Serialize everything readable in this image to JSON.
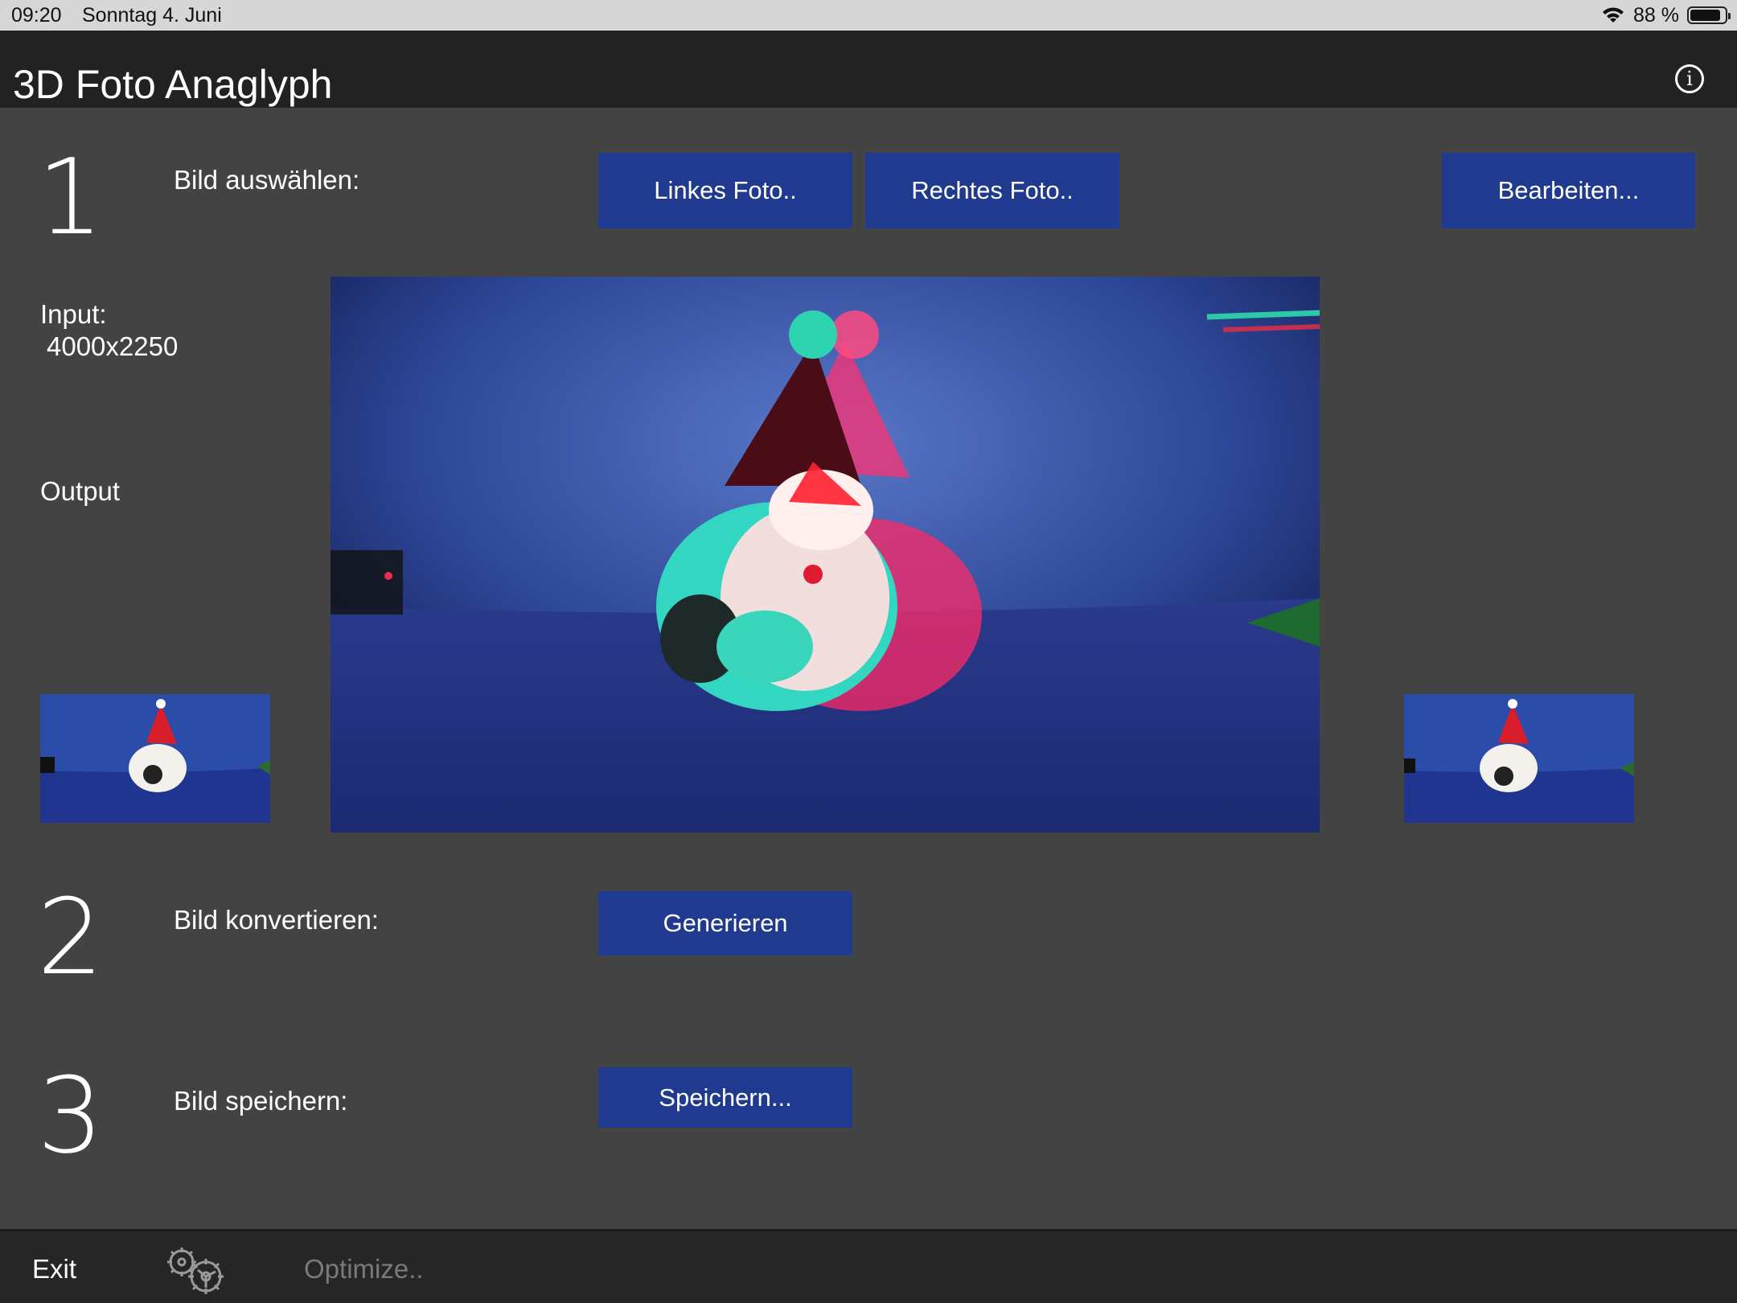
{
  "status_bar": {
    "time": "09:20",
    "date": "Sonntag 4. Juni",
    "battery_percent": "88 %",
    "battery_level": 0.88
  },
  "header": {
    "title": "3D Foto Anaglyph",
    "info_icon": "info-circle-icon"
  },
  "step1": {
    "number": "1",
    "label": "Bild auswählen:",
    "left_photo_button": "Linkes Foto..",
    "right_photo_button": "Rechtes Foto..",
    "edit_button": "Bearbeiten..."
  },
  "info": {
    "input_label": "Input:",
    "input_resolution": "4000x2250",
    "output_label": "Output"
  },
  "step2": {
    "number": "2",
    "label": "Bild konvertieren:",
    "generate_button": "Generieren"
  },
  "step3": {
    "number": "3",
    "label": "Bild speichern:",
    "save_button": "Speichern..."
  },
  "bottom_bar": {
    "exit_label": "Exit",
    "settings_icon": "gears-icon",
    "optimize_label": "Optimize.."
  },
  "colors": {
    "background": "#434343",
    "titlebar": "#222222",
    "button": "#1f3a8e",
    "disabled_text": "#7a7a7a"
  }
}
